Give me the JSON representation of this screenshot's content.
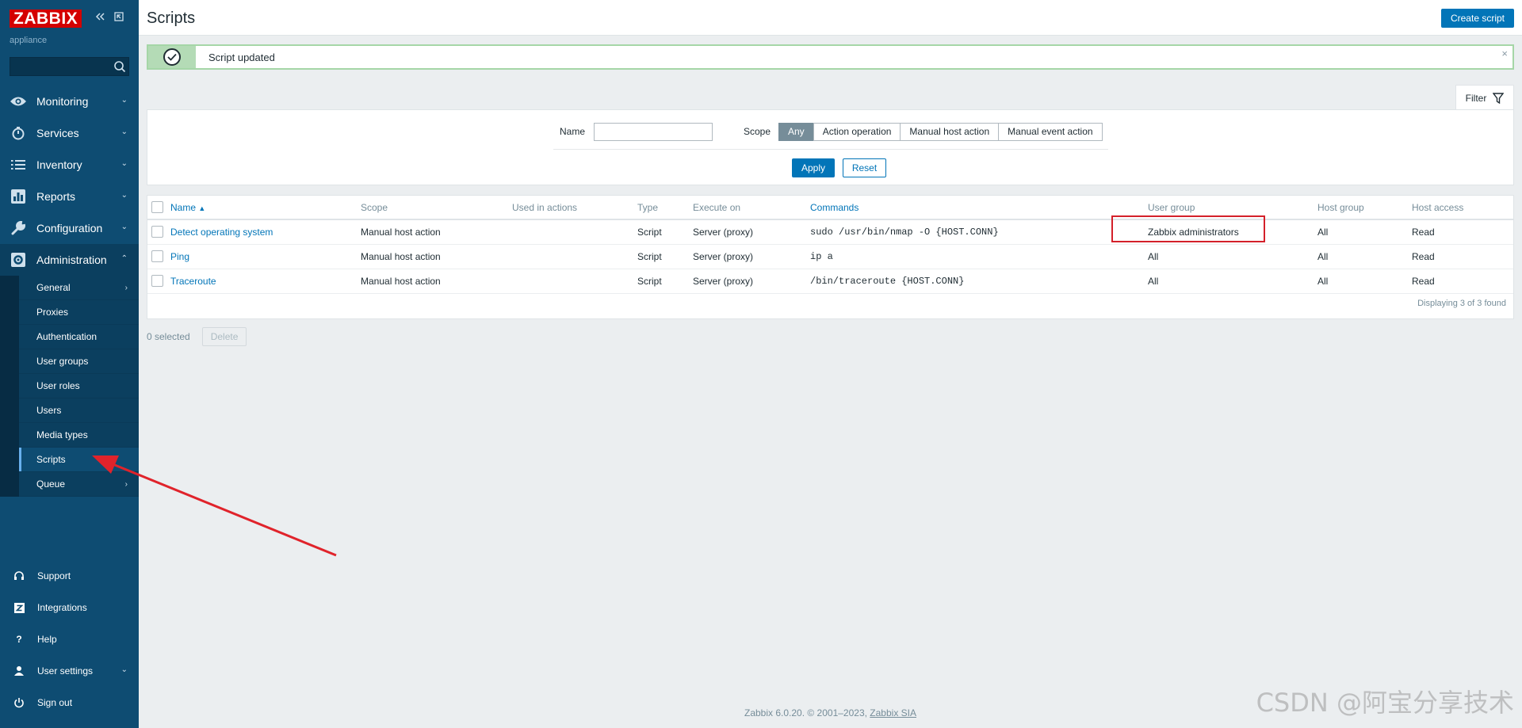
{
  "app": {
    "logo_text": "ZABBIX",
    "server_name": "appliance",
    "search": {
      "value": "",
      "placeholder": ""
    }
  },
  "sidebar": {
    "main_menu": [
      {
        "label": "Monitoring",
        "icon": "eye-icon"
      },
      {
        "label": "Services",
        "icon": "stopwatch-icon"
      },
      {
        "label": "Inventory",
        "icon": "list-icon"
      },
      {
        "label": "Reports",
        "icon": "bar-chart-icon"
      },
      {
        "label": "Configuration",
        "icon": "wrench-icon"
      },
      {
        "label": "Administration",
        "icon": "gear-icon"
      }
    ],
    "admin_submenu": [
      {
        "label": "General"
      },
      {
        "label": "Proxies"
      },
      {
        "label": "Authentication"
      },
      {
        "label": "User groups"
      },
      {
        "label": "User roles"
      },
      {
        "label": "Users"
      },
      {
        "label": "Media types"
      },
      {
        "label": "Scripts"
      },
      {
        "label": "Queue"
      }
    ],
    "bottom_menu": [
      {
        "label": "Support",
        "icon": "headset-icon"
      },
      {
        "label": "Integrations",
        "icon": "zabbix-z-icon"
      },
      {
        "label": "Help",
        "icon": "question-icon"
      },
      {
        "label": "User settings",
        "icon": "user-icon"
      },
      {
        "label": "Sign out",
        "icon": "power-icon"
      }
    ]
  },
  "header": {
    "title": "Scripts",
    "create_button": "Create script"
  },
  "message": {
    "text": "Script updated",
    "close": "×"
  },
  "filter": {
    "tab_label": "Filter",
    "name_label": "Name",
    "name_value": "",
    "scope_label": "Scope",
    "scope_options": [
      "Any",
      "Action operation",
      "Manual host action",
      "Manual event action"
    ],
    "scope_selected": "Any",
    "apply": "Apply",
    "reset": "Reset"
  },
  "table": {
    "columns": {
      "name": "Name",
      "sort_indicator": "▲",
      "scope": "Scope",
      "used_in_actions": "Used in actions",
      "type": "Type",
      "execute_on": "Execute on",
      "commands": "Commands",
      "user_group": "User group",
      "host_group": "Host group",
      "host_access": "Host access"
    },
    "rows": [
      {
        "name": "Detect operating system",
        "scope": "Manual host action",
        "used_in_actions": "",
        "type": "Script",
        "execute_on": "Server (proxy)",
        "commands": "sudo /usr/bin/nmap -O {HOST.CONN}",
        "user_group": "Zabbix administrators",
        "host_group": "All",
        "host_access": "Read"
      },
      {
        "name": "Ping",
        "scope": "Manual host action",
        "used_in_actions": "",
        "type": "Script",
        "execute_on": "Server (proxy)",
        "commands": "ip a",
        "user_group": "All",
        "host_group": "All",
        "host_access": "Read"
      },
      {
        "name": "Traceroute",
        "scope": "Manual host action",
        "used_in_actions": "",
        "type": "Script",
        "execute_on": "Server (proxy)",
        "commands": "/bin/traceroute {HOST.CONN}",
        "user_group": "All",
        "host_group": "All",
        "host_access": "Read"
      }
    ],
    "paging": "Displaying 3 of 3 found"
  },
  "actions": {
    "selected_count": "0 selected",
    "delete": "Delete"
  },
  "footer": {
    "text": "Zabbix 6.0.20. © 2001–2023, ",
    "link": "Zabbix SIA"
  },
  "watermark": "CSDN @阿宝分享技术",
  "colors": {
    "sidebar_bg": "#0e4c72",
    "accent": "#0275b8",
    "logo_red": "#d40000",
    "success_border": "#a5d6a7",
    "annotation_red": "#d4202a"
  }
}
